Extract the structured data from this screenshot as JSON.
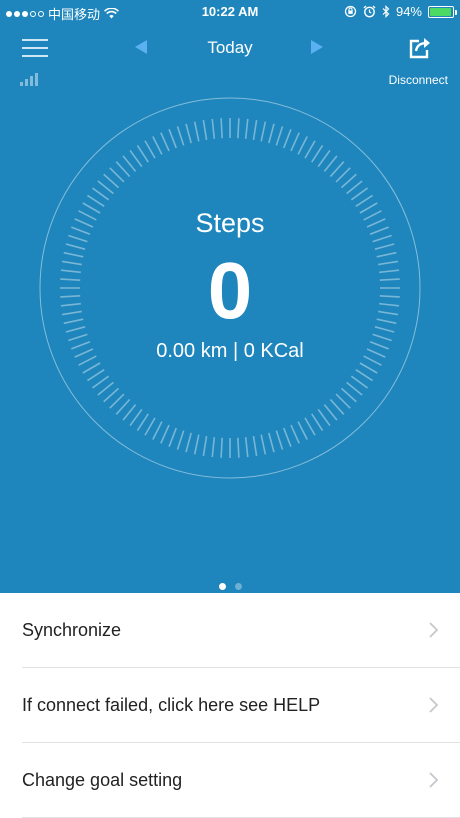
{
  "status_bar": {
    "carrier": "中国移动",
    "time": "10:22 AM",
    "battery": "94%",
    "battery_level": 0.94
  },
  "nav": {
    "title": "Today",
    "disconnect_label": "Disconnect"
  },
  "activity": {
    "steps_label": "Steps",
    "steps_value": "0",
    "summary": "0.00 km | 0 KCal"
  },
  "pager": {
    "pages": 2,
    "active": 0
  },
  "menu": {
    "items": [
      {
        "label": "Synchronize"
      },
      {
        "label": "If connect failed, click here see HELP"
      },
      {
        "label": "Change goal setting"
      }
    ]
  },
  "colors": {
    "primary": "#1e86bc",
    "nav_arrow": "#5ab0f0",
    "battery_fill": "#4cd964"
  }
}
